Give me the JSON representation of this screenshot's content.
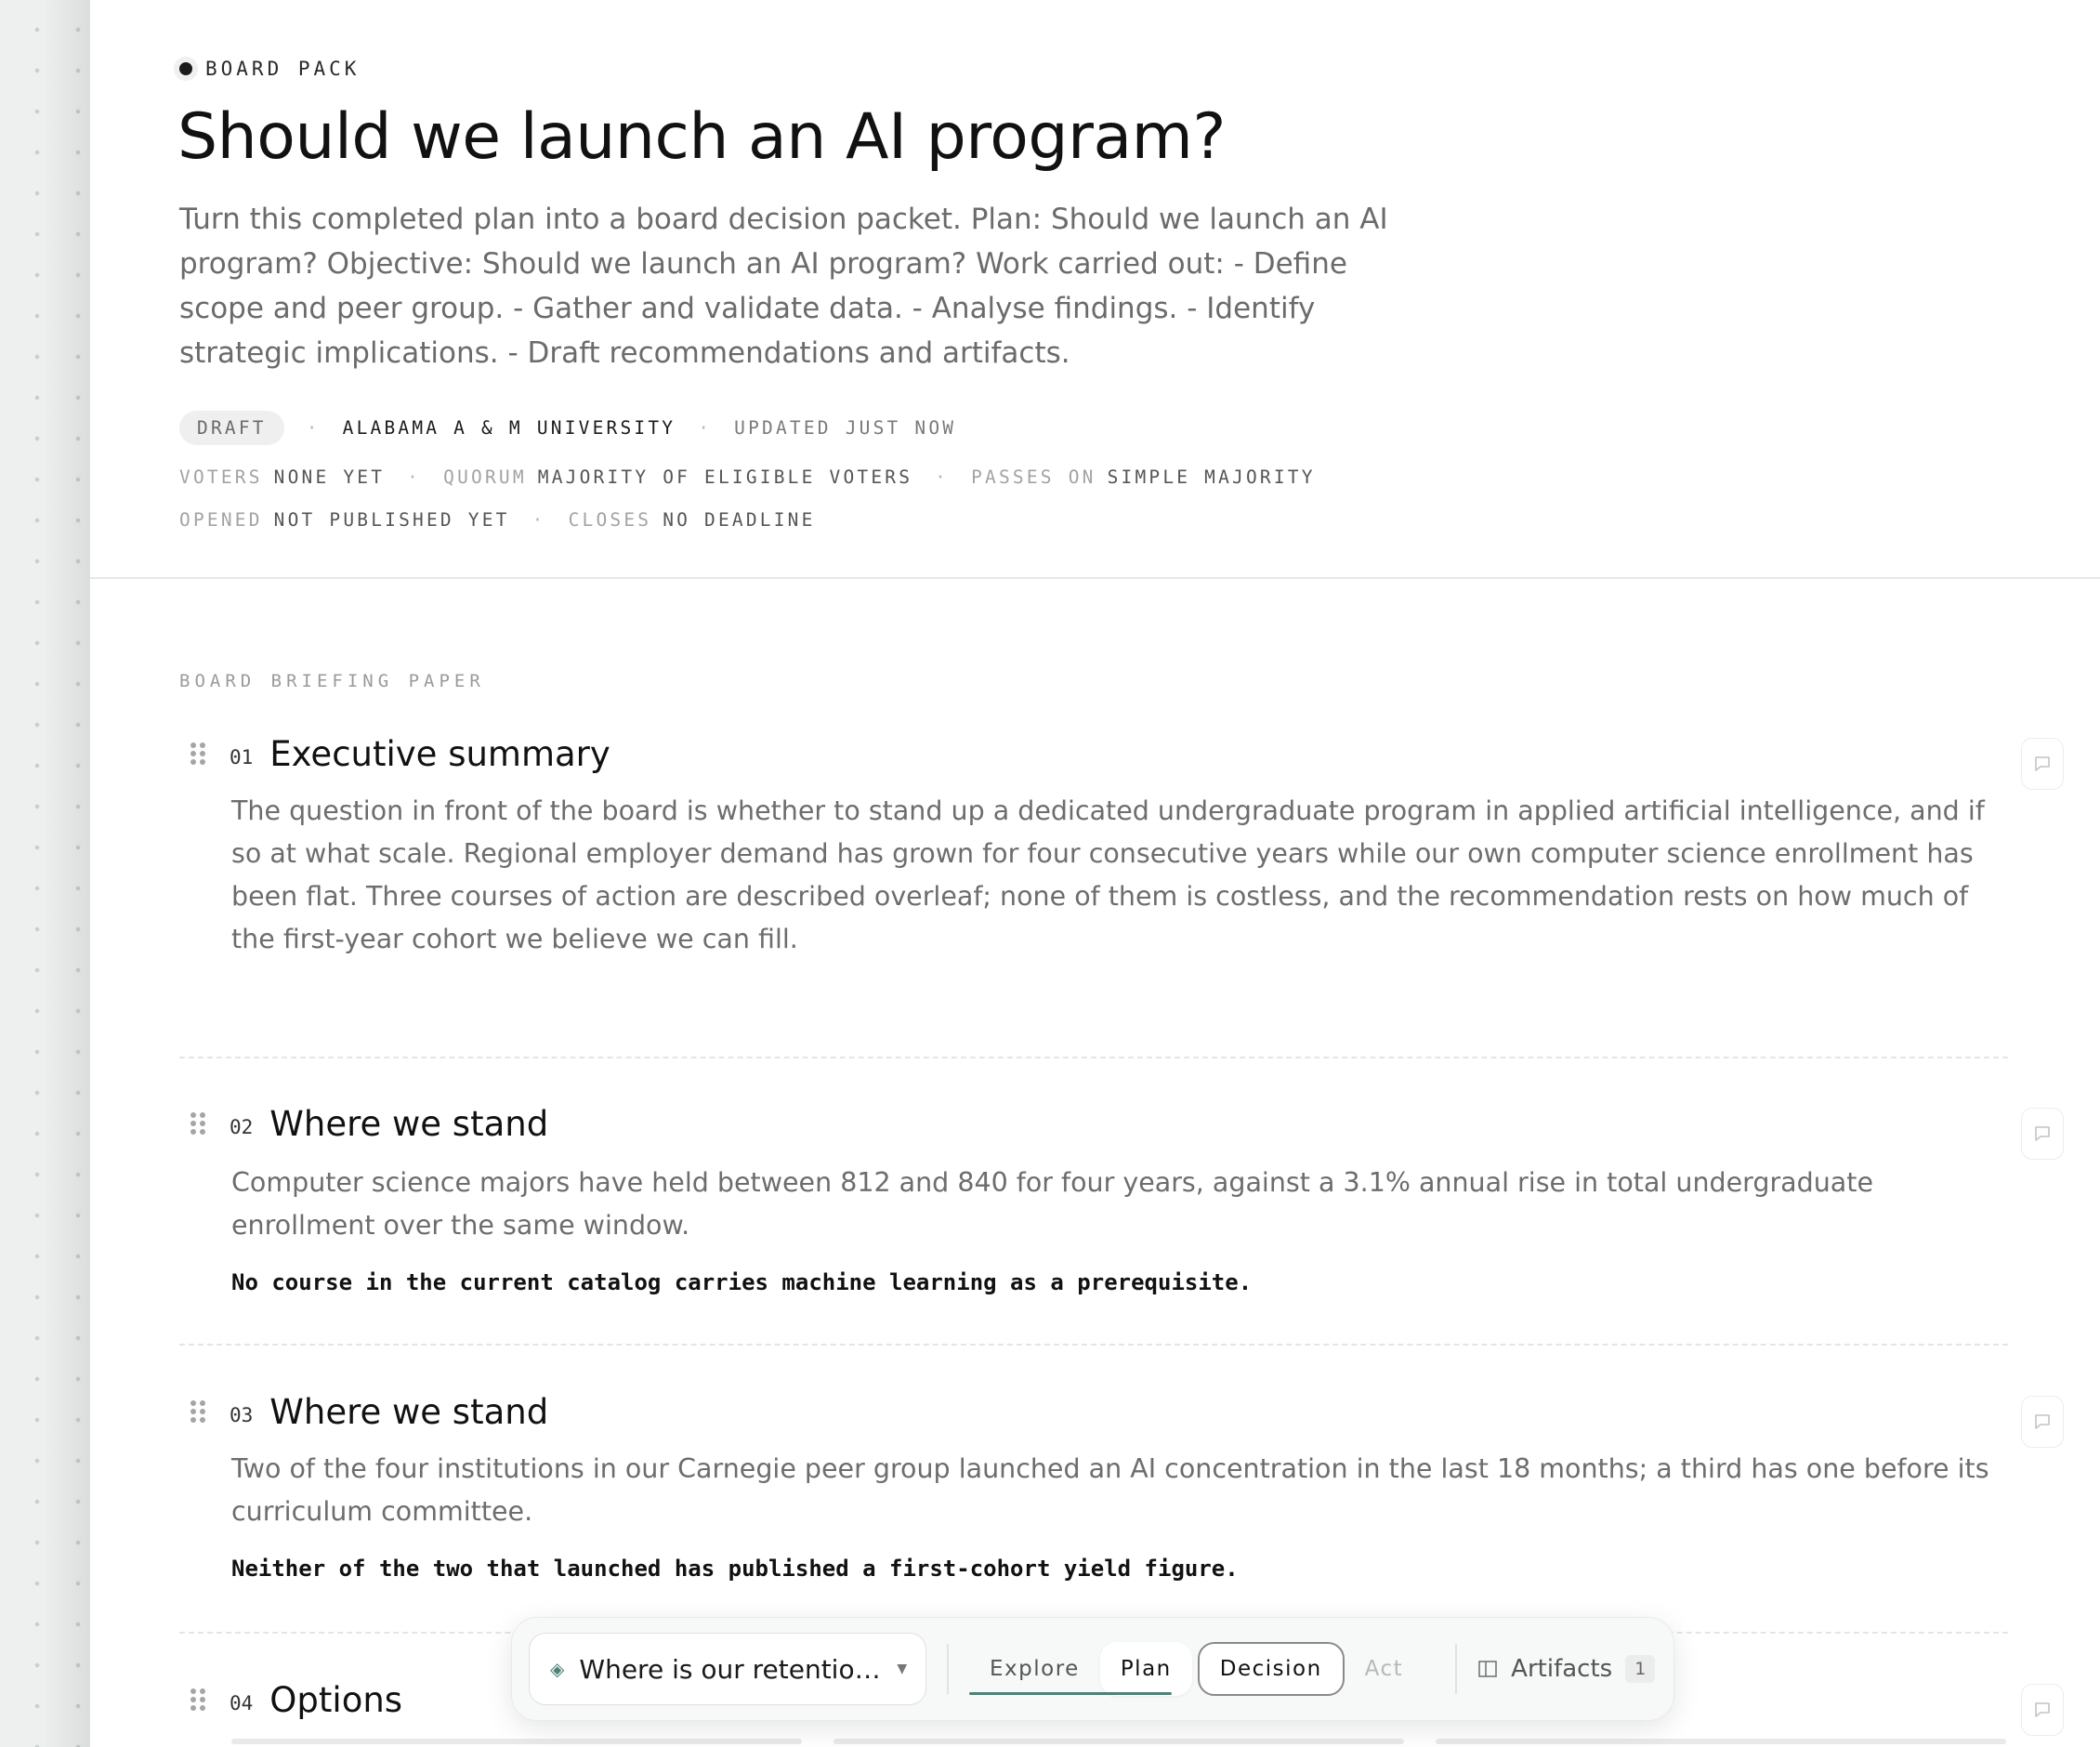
{
  "header": {
    "eyebrow": "BOARD PACK",
    "title": "Should we launch an AI program?",
    "subtitle": "Turn this completed plan into a board decision packet. Plan: Should we launch an AI program? Objective: Should we launch an AI program? Work carried out: - Define scope and peer group. - Gather and validate data. - Analyse findings. - Identify strategic implications. - Draft recommendations and artifacts.",
    "status": "DRAFT",
    "institution": "ALABAMA A & M UNIVERSITY",
    "updated": "UPDATED JUST NOW",
    "voters_label": "VOTERS",
    "voters_value": "NONE YET",
    "quorum_label": "QUORUM",
    "quorum_value": "MAJORITY OF ELIGIBLE VOTERS",
    "passes_label": "PASSES ON",
    "passes_value": "SIMPLE MAJORITY",
    "opened_label": "OPENED",
    "opened_value": "NOT PUBLISHED YET",
    "closes_label": "CLOSES",
    "closes_value": "NO DEADLINE"
  },
  "paper": {
    "kicker": "BOARD BRIEFING PAPER",
    "sections": [
      {
        "num": "01",
        "title": "Executive summary",
        "body": "The question in front of the board is whether to stand up a dedicated undergraduate program in applied artificial intelligence, and if so at what scale. Regional employer demand has grown for four consecutive years while our own computer science enrollment has been flat. Three courses of action are described overleaf; none of them is costless, and the recommendation rests on how much of the first-year cohort we believe we can fill."
      },
      {
        "num": "02",
        "title": "Where we stand",
        "body": "Computer science majors have held between 812 and 840 for four years, against a 3.1% annual rise in total undergraduate enrollment over the same window.",
        "strong": "No course in the current catalog carries machine learning as a prerequisite."
      },
      {
        "num": "03",
        "title": "Where we stand",
        "body": "Two of the four institutions in our Carnegie peer group launched an AI concentration in the last 18 months; a third has one before its curriculum committee.",
        "strong": "Neither of the two that launched has published a first-cohort yield figure."
      },
      {
        "num": "04",
        "title": "Options"
      }
    ]
  },
  "toolbar": {
    "question": "Where is our retention t...",
    "tabs": [
      "Explore",
      "Plan",
      "Decision",
      "Act"
    ],
    "artifacts_label": "Artifacts",
    "artifacts_count": "1"
  },
  "colors": {
    "accent": "#4e8277",
    "text": "#111111",
    "muted": "#6d6d6d"
  }
}
